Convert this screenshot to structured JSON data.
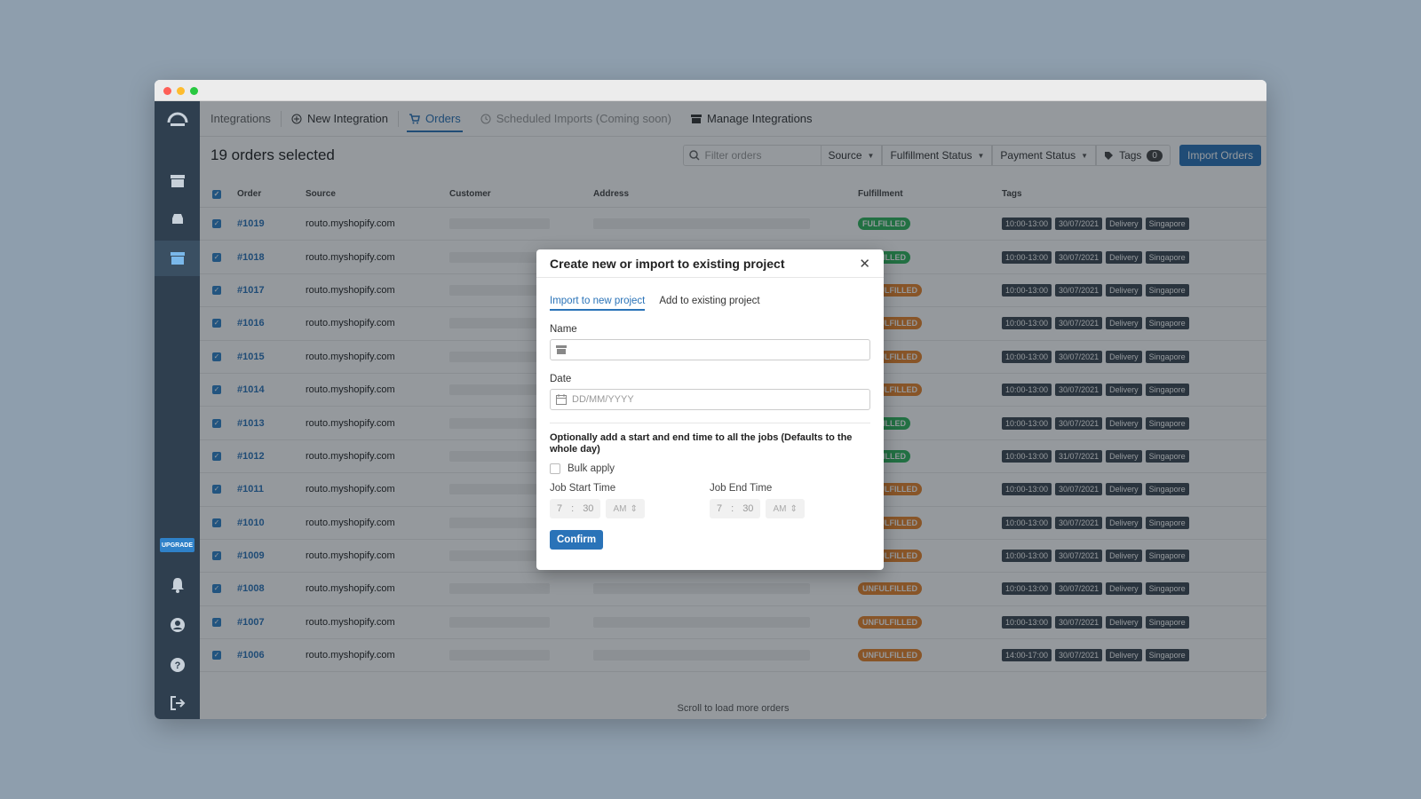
{
  "nav": {
    "integrations": "Integrations",
    "new_integration": "New Integration",
    "orders": "Orders",
    "scheduled_imports": "Scheduled Imports (Coming soon)",
    "manage_integrations": "Manage Integrations"
  },
  "sidebar": {
    "upgrade": "UPGRADE"
  },
  "toolbar": {
    "title": "19 orders selected",
    "filter_placeholder": "Filter orders",
    "source": "Source",
    "fulfillment_status": "Fulfillment Status",
    "payment_status": "Payment Status",
    "tags": "Tags",
    "tags_count": "0",
    "import_button": "Import Orders"
  },
  "table": {
    "headers": [
      "Order",
      "Source",
      "Customer",
      "Address",
      "Fulfillment",
      "Tags"
    ],
    "rows": [
      {
        "order": "#1019",
        "source": "routo.myshopify.com",
        "fulfillment": "FULFILLED",
        "tags": [
          "10:00-13:00",
          "30/07/2021",
          "Delivery",
          "Singapore"
        ]
      },
      {
        "order": "#1018",
        "source": "routo.myshopify.com",
        "fulfillment": "FULFILLED",
        "tags": [
          "10:00-13:00",
          "30/07/2021",
          "Delivery",
          "Singapore"
        ]
      },
      {
        "order": "#1017",
        "source": "routo.myshopify.com",
        "fulfillment": "UNFULFILLED",
        "tags": [
          "10:00-13:00",
          "30/07/2021",
          "Delivery",
          "Singapore"
        ]
      },
      {
        "order": "#1016",
        "source": "routo.myshopify.com",
        "fulfillment": "UNFULFILLED",
        "tags": [
          "10:00-13:00",
          "30/07/2021",
          "Delivery",
          "Singapore"
        ]
      },
      {
        "order": "#1015",
        "source": "routo.myshopify.com",
        "fulfillment": "UNFULFILLED",
        "tags": [
          "10:00-13:00",
          "30/07/2021",
          "Delivery",
          "Singapore"
        ]
      },
      {
        "order": "#1014",
        "source": "routo.myshopify.com",
        "fulfillment": "UNFULFILLED",
        "tags": [
          "10:00-13:00",
          "30/07/2021",
          "Delivery",
          "Singapore"
        ]
      },
      {
        "order": "#1013",
        "source": "routo.myshopify.com",
        "fulfillment": "FULFILLED",
        "tags": [
          "10:00-13:00",
          "30/07/2021",
          "Delivery",
          "Singapore"
        ]
      },
      {
        "order": "#1012",
        "source": "routo.myshopify.com",
        "fulfillment": "FULFILLED",
        "tags": [
          "10:00-13:00",
          "31/07/2021",
          "Delivery",
          "Singapore"
        ]
      },
      {
        "order": "#1011",
        "source": "routo.myshopify.com",
        "fulfillment": "UNFULFILLED",
        "tags": [
          "10:00-13:00",
          "30/07/2021",
          "Delivery",
          "Singapore"
        ]
      },
      {
        "order": "#1010",
        "source": "routo.myshopify.com",
        "fulfillment": "UNFULFILLED",
        "tags": [
          "10:00-13:00",
          "30/07/2021",
          "Delivery",
          "Singapore"
        ]
      },
      {
        "order": "#1009",
        "source": "routo.myshopify.com",
        "fulfillment": "UNFULFILLED",
        "tags": [
          "10:00-13:00",
          "30/07/2021",
          "Delivery",
          "Singapore"
        ]
      },
      {
        "order": "#1008",
        "source": "routo.myshopify.com",
        "fulfillment": "UNFULFILLED",
        "tags": [
          "10:00-13:00",
          "30/07/2021",
          "Delivery",
          "Singapore"
        ]
      },
      {
        "order": "#1007",
        "source": "routo.myshopify.com",
        "fulfillment": "UNFULFILLED",
        "tags": [
          "10:00-13:00",
          "30/07/2021",
          "Delivery",
          "Singapore"
        ]
      },
      {
        "order": "#1006",
        "source": "routo.myshopify.com",
        "fulfillment": "UNFULFILLED",
        "tags": [
          "14:00-17:00",
          "30/07/2021",
          "Delivery",
          "Singapore"
        ]
      }
    ],
    "footer": "Scroll to load more orders"
  },
  "modal": {
    "title": "Create new or import to existing project",
    "tab_new": "Import to new project",
    "tab_existing": "Add to existing project",
    "name_label": "Name",
    "date_label": "Date",
    "date_placeholder": "DD/MM/YYYY",
    "note": "Optionally add a start and end time to all the jobs (Defaults to the whole day)",
    "bulk_apply": "Bulk apply",
    "start_label": "Job Start Time",
    "end_label": "Job End Time",
    "start_hour": "7",
    "start_min": "30",
    "start_ampm": "AM",
    "end_hour": "7",
    "end_min": "30",
    "end_ampm": "AM",
    "confirm": "Confirm"
  },
  "colors": {
    "accent": "#2a73b8",
    "fulfilled": "#2eb55c",
    "unfulfilled": "#e8832a",
    "sidebar": "#2f3f4f"
  }
}
